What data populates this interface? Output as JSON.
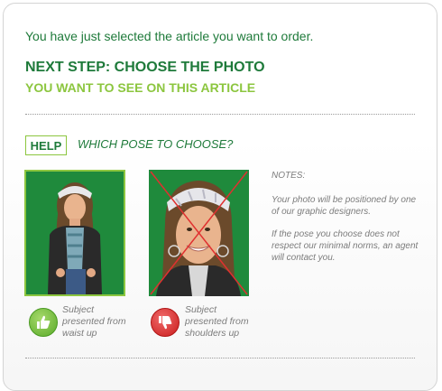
{
  "intro_text": "You have just selected the article you want to order.",
  "next_step": {
    "title": "NEXT STEP: CHOOSE THE PHOTO",
    "subtitle": "YOU WANT TO SEE ON THIS ARTICLE"
  },
  "help": {
    "badge": "HELP",
    "question": "WHICH POSE TO CHOOSE?"
  },
  "examples": [
    {
      "icon": "thumbs-up-icon",
      "caption_line1": "Subject",
      "caption_line2": "presented from",
      "caption_line3": "waist up",
      "status_color": "#6bb52e"
    },
    {
      "icon": "thumbs-down-icon",
      "caption_line1": "Subject",
      "caption_line2": "presented from",
      "caption_line3": "shoulders up",
      "status_color": "#d42222"
    }
  ],
  "notes": {
    "title": "NOTES:",
    "paragraph1": "Your photo will be positioned by one of our graphic designers.",
    "paragraph2": "If the pose you choose does not respect our minimal norms, an agent will contact you."
  },
  "colors": {
    "dark_green": "#1e7a3a",
    "light_green": "#8cc63f",
    "photo_background": "#1f8a3c",
    "cross_red": "#e03030"
  }
}
